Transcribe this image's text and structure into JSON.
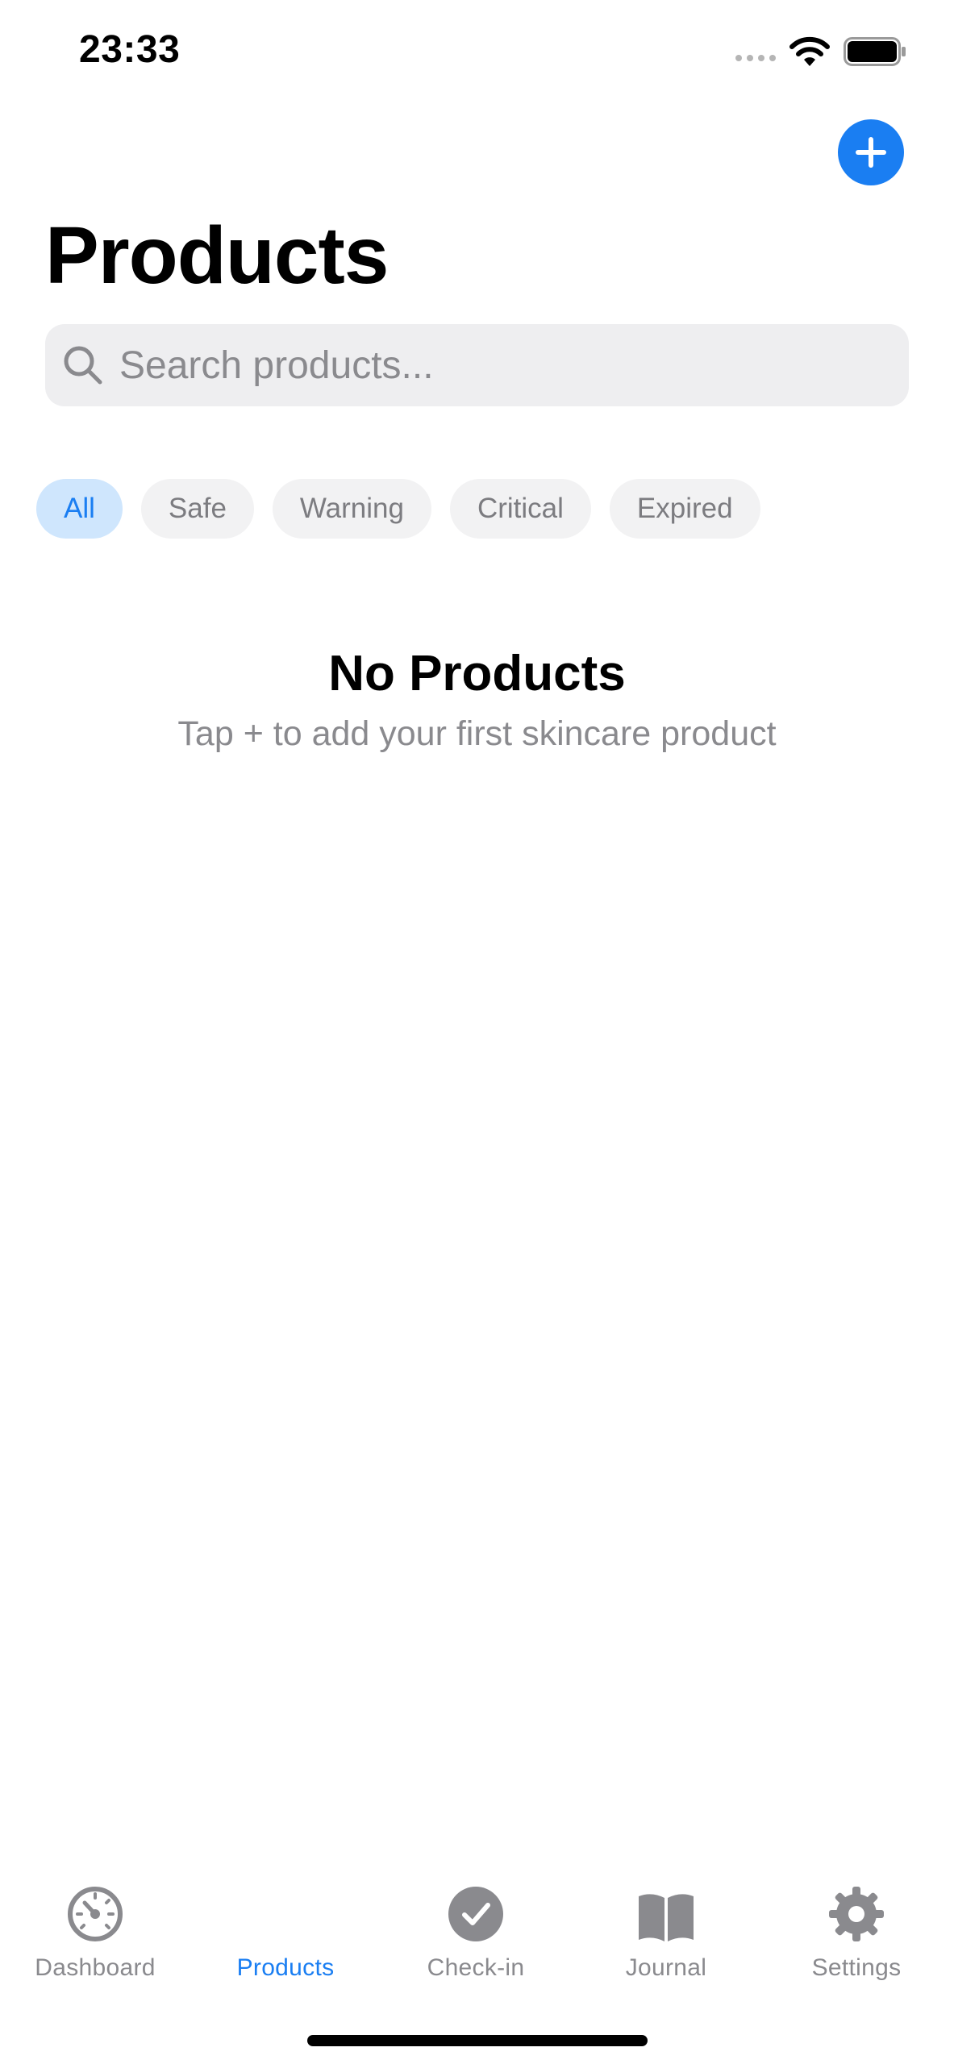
{
  "status_bar": {
    "time": "23:33"
  },
  "header": {
    "title": "Products",
    "add_icon": "plus-icon"
  },
  "search": {
    "placeholder": "Search products...",
    "value": ""
  },
  "filters": {
    "active": "All",
    "items": [
      "All",
      "Safe",
      "Warning",
      "Critical",
      "Expired"
    ]
  },
  "empty_state": {
    "title": "No Products",
    "subtitle": "Tap + to add your first skincare product"
  },
  "tab_bar": {
    "active": "Products",
    "items": [
      {
        "label": "Dashboard",
        "icon": "gauge-icon"
      },
      {
        "label": "Products",
        "icon": "products-icon"
      },
      {
        "label": "Check-in",
        "icon": "checkmark-circle-icon"
      },
      {
        "label": "Journal",
        "icon": "book-icon"
      },
      {
        "label": "Settings",
        "icon": "gear-icon"
      }
    ]
  },
  "colors": {
    "accent": "#1a7ef2",
    "chip_active_bg": "#cfe6fd",
    "chip_bg": "#f2f2f3",
    "secondary_text": "#8a8a8e",
    "search_bg": "#eeeef0"
  }
}
